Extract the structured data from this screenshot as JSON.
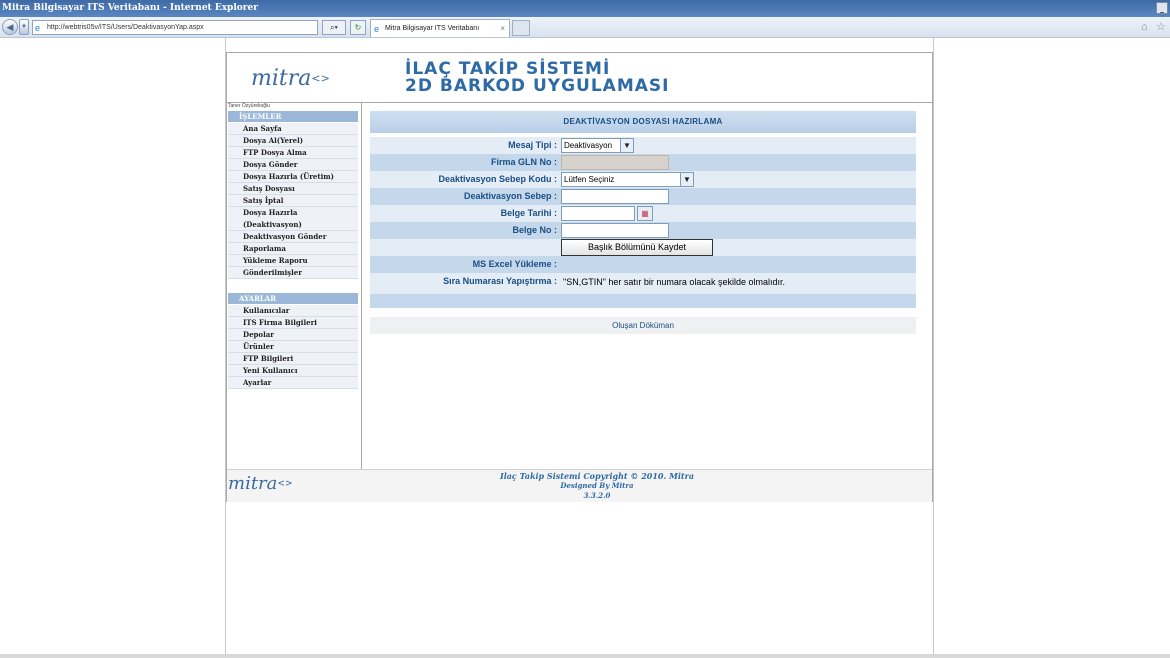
{
  "window": {
    "title": "Mitra Bilgisayar ITS Veritabanı - Internet Explorer"
  },
  "browser": {
    "address": "http://webtris05v/ITS/Users/DeaktivasyonYap.aspx",
    "tab_title": "Mitra Bilgisayar ITS Veritabanı",
    "tab_close": "×"
  },
  "header": {
    "logo": "mitra",
    "logo_brackets": "<>",
    "title_line1": "İLAÇ TAKİP SİSTEMİ",
    "title_line2": "2D BARKOD UYGULAMASI"
  },
  "user": {
    "name": "Taner Özyürekoğlu"
  },
  "sidebar": {
    "islemler_heading": "İŞLEMLER",
    "islemler": [
      {
        "label": "Ana Sayfa"
      },
      {
        "label": "Dosya Al(Yerel)"
      },
      {
        "label": "FTP Dosya Alma"
      },
      {
        "label": "Dosya Gönder"
      },
      {
        "label": "Dosya Hazırla (Üretim)"
      },
      {
        "label": "Satış Dosyası"
      },
      {
        "label": "Satış İptal"
      },
      {
        "label": "Dosya Hazırla"
      },
      {
        "label": "(Deaktivasyon)"
      },
      {
        "label": "Deaktivasyon Gönder"
      },
      {
        "label": "Raporlama"
      },
      {
        "label": "Yükleme Raporu"
      },
      {
        "label": "Gönderilmişler"
      }
    ],
    "ayarlar_heading": "AYARLAR",
    "ayarlar": [
      {
        "label": "Kullanıcılar"
      },
      {
        "label": "ITS Firma Bilgileri"
      },
      {
        "label": "Depolar"
      },
      {
        "label": "Ürünler"
      },
      {
        "label": "FTP Bilgileri"
      },
      {
        "label": "Yeni Kullanıcı"
      },
      {
        "label": "Ayarlar"
      }
    ]
  },
  "form": {
    "title": "DEAKTİVASYON DOSYASI HAZIRLAMA",
    "mesaj_tipi_label": "Mesaj Tipi :",
    "mesaj_tipi_value": "Deaktivasyon",
    "firma_gln_label": "Firma GLN No :",
    "sebep_kodu_label": "Deaktivasyon Sebep Kodu :",
    "sebep_kodu_value": "Lütfen Seçiniz",
    "sebep_label": "Deaktivasyon Sebep :",
    "belge_tarihi_label": "Belge Tarihi :",
    "belge_no_label": "Belge No :",
    "save_button": "Başlık Bölümünü Kaydet",
    "excel_label": "MS Excel Yükleme :",
    "sira_label": "Sıra Numarası Yapıştırma :",
    "sira_hint": "\"SN,GTIN\" her satır bir numara olacak şekilde olmalıdır.",
    "doc_link": "Oluşan Döküman"
  },
  "footer": {
    "line1": "Ilaç Takip Sistemi   Copyright © 2010. Mitra",
    "line2": "Designed By  Mitra",
    "version": "3.3.2.0"
  }
}
